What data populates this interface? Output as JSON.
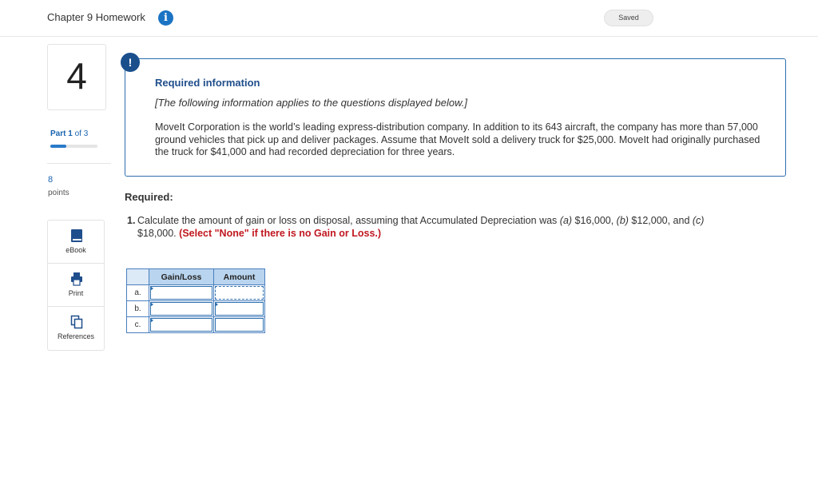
{
  "header": {
    "title": "Chapter 9 Homework",
    "info_icon": "i",
    "saved": "Saved"
  },
  "question_panel": {
    "number": "4",
    "part_label": "Part 1",
    "part_of": "of 3",
    "progress_fraction": 0.333,
    "points_value": "8",
    "points_label": "points"
  },
  "tools": [
    {
      "label": "eBook",
      "icon": "book-icon"
    },
    {
      "label": "Print",
      "icon": "printer-icon"
    },
    {
      "label": "References",
      "icon": "copy-icon"
    }
  ],
  "required_info": {
    "alert": "!",
    "heading": "Required information",
    "intro": "[The following information applies to the questions displayed below.]",
    "body": "MoveIt Corporation is the world’s leading express-distribution company. In addition to its 643 aircraft, the company has more than 57,000 ground vehicles that pick up and deliver packages. Assume that MoveIt sold a delivery truck for $25,000. MoveIt had originally purchased the truck for $41,000 and had recorded depreciation for three years."
  },
  "required": {
    "heading": "Required:",
    "q_number": "1.",
    "q_text_1": "Calculate the amount of gain or loss on disposal, assuming that Accumulated Depreciation was ",
    "q_a_label": "(a)",
    "q_a_val": " $16,000, ",
    "q_b_label": "(b)",
    "q_b_val": " $12,000, and ",
    "q_c_label": "(c)",
    "q_c_val": "$18,000.",
    "q_red": "(Select \"None\" if there is no Gain or Loss.)"
  },
  "answer_table": {
    "headers": [
      "",
      "Gain/Loss",
      "Amount"
    ],
    "rows": [
      {
        "label": "a.",
        "gain_loss": "",
        "amount": ""
      },
      {
        "label": "b.",
        "gain_loss": "",
        "amount": ""
      },
      {
        "label": "c.",
        "gain_loss": "",
        "amount": ""
      }
    ]
  }
}
